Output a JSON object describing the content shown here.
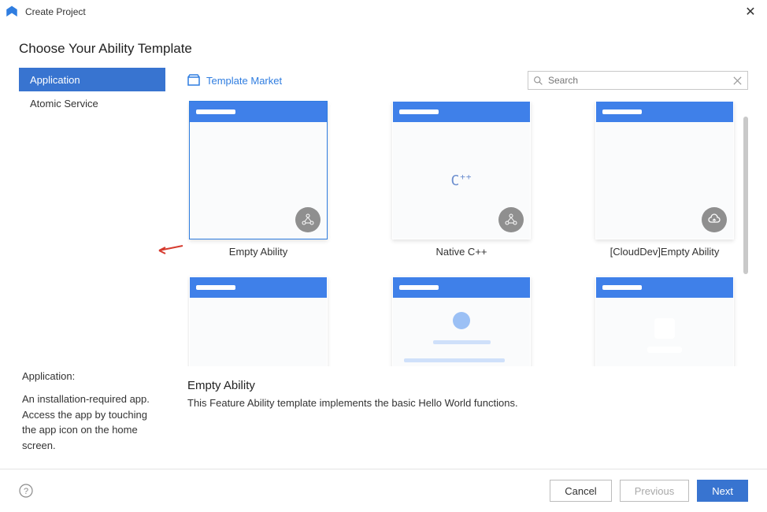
{
  "window": {
    "title": "Create Project"
  },
  "heading": "Choose Your Ability Template",
  "sidebar": {
    "categories": [
      {
        "label": "Application",
        "selected": true
      },
      {
        "label": "Atomic Service",
        "selected": false
      }
    ],
    "description": {
      "title": "Application:",
      "body": "An installation-required app. Access the app by touching the app icon on the home screen."
    }
  },
  "market_link": "Template Market",
  "search": {
    "placeholder": "Search",
    "value": ""
  },
  "templates_row1": [
    {
      "name": "Empty Ability",
      "kind": "empty",
      "selected": true
    },
    {
      "name": "Native C++",
      "kind": "cpp",
      "selected": false
    },
    {
      "name": "[CloudDev]Empty Ability",
      "kind": "cloud",
      "selected": false
    }
  ],
  "templates_row2": [
    {
      "name": "",
      "kind": "empty2"
    },
    {
      "name": "",
      "kind": "list"
    },
    {
      "name": "",
      "kind": "clouddetail"
    }
  ],
  "selected_detail": {
    "title": "Empty Ability",
    "desc": "This Feature Ability template implements the basic Hello World functions."
  },
  "footer": {
    "cancel": "Cancel",
    "previous": "Previous",
    "next": "Next"
  }
}
